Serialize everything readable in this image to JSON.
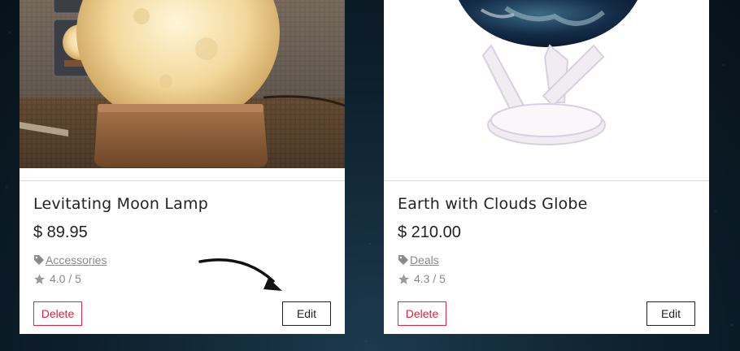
{
  "products": [
    {
      "title": "Levitating Moon Lamp",
      "price": "$ 89.95",
      "category": "Accessories",
      "rating": "4.0 / 5",
      "delete_label": "Delete",
      "edit_label": "Edit",
      "image_icon": "moon-lamp-image"
    },
    {
      "title": "Earth with Clouds Globe",
      "price": "$ 210.00",
      "category": "Deals",
      "rating": "4.3 / 5",
      "delete_label": "Delete",
      "edit_label": "Edit",
      "image_icon": "earth-globe-image"
    }
  ],
  "icons": {
    "category": "tag-icon",
    "rating": "star-icon",
    "annotation": "arrow-icon"
  },
  "colors": {
    "delete": "#d9283f",
    "text": "#222222",
    "muted": "#8a8a8a",
    "background": "#0b1a26"
  }
}
